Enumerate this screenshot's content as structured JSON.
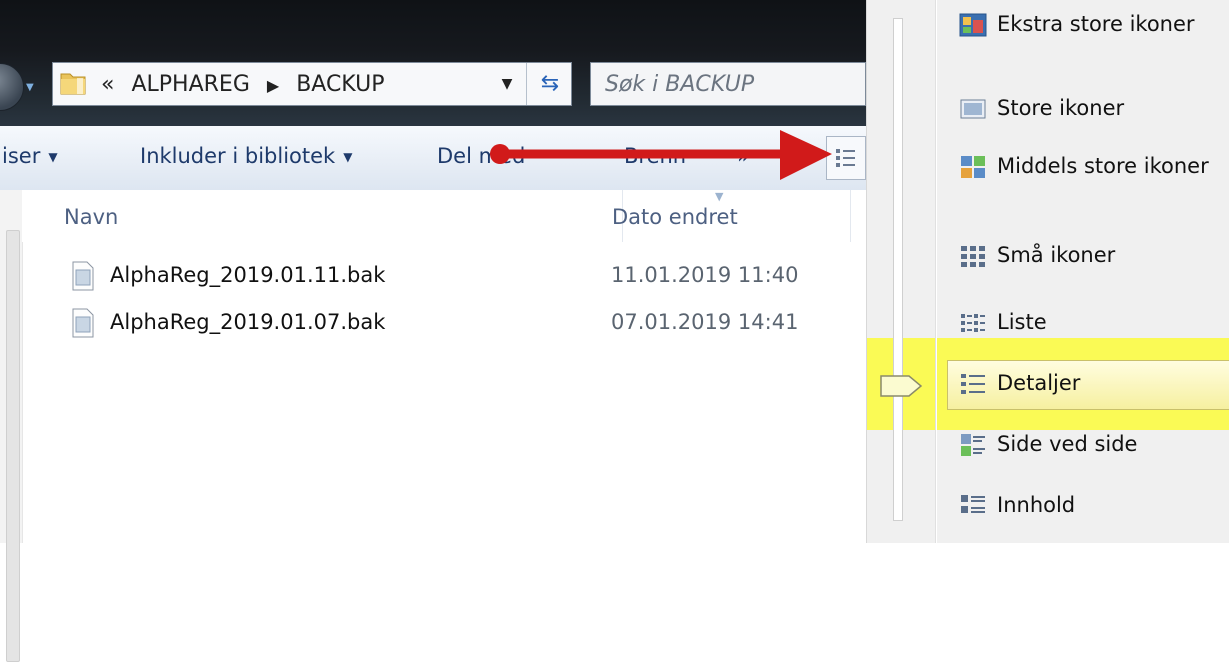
{
  "address": {
    "overflow": "«",
    "crumb1": "ALPHAREG",
    "crumb2": "BACKUP"
  },
  "search": {
    "placeholder": "Søk i BACKUP"
  },
  "toolbar": {
    "organize": "iser",
    "include_library": "Inkluder i bibliotek",
    "share": "Del med",
    "burn": "Brenn",
    "more": "»"
  },
  "columns": {
    "name": "Navn",
    "date": "Dato endret"
  },
  "files": [
    {
      "name": "AlphaReg_2019.01.11.bak",
      "date": "11.01.2019 11:40"
    },
    {
      "name": "AlphaReg_2019.01.07.bak",
      "date": "07.01.2019 14:41"
    }
  ],
  "view_menu": {
    "items": [
      {
        "label": "Ekstra store ikoner",
        "icon": "extra-large-icons-icon"
      },
      {
        "label": "Store ikoner",
        "icon": "large-icons-icon"
      },
      {
        "label": "Middels store ikoner",
        "icon": "medium-icons-icon"
      },
      {
        "label": "Små ikoner",
        "icon": "small-icons-icon"
      },
      {
        "label": "Liste",
        "icon": "list-icon"
      },
      {
        "label": "Detaljer",
        "icon": "details-icon"
      },
      {
        "label": "Side ved side",
        "icon": "tiles-icon"
      },
      {
        "label": "Innhold",
        "icon": "content-icon"
      }
    ],
    "selected": "Detaljer"
  },
  "colors": {
    "highlight": "#fbfb3a",
    "arrow": "#d11a1a"
  }
}
